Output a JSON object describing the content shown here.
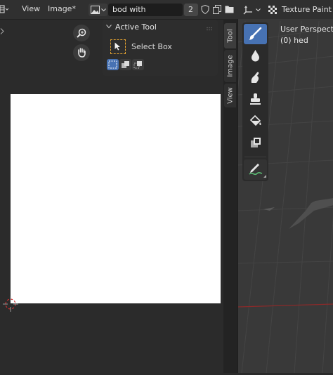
{
  "image_editor": {
    "menu": {
      "view": "View",
      "image": "Image*"
    },
    "image_name": "bod with",
    "users_count": "2",
    "npanel": {
      "section_title": "Active Tool",
      "tool_name": "Select Box"
    },
    "tabs": {
      "tool": "Tool",
      "image": "Image",
      "view": "View"
    }
  },
  "viewport": {
    "mode": "Texture Paint",
    "perspective_label": "User Perspective",
    "object_label": "(0) hed"
  },
  "colors": {
    "accent": "#4772b3",
    "canvas": "#ffffff",
    "axis_x": "#c0393b"
  }
}
